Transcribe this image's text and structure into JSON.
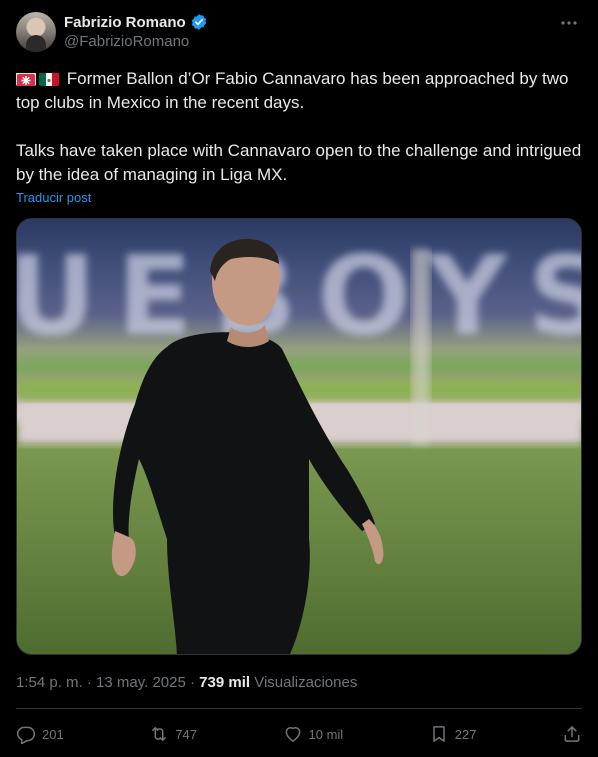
{
  "author": {
    "name": "Fabrizio Romano",
    "handle": "@FabrizioRomano",
    "verified": true
  },
  "post": {
    "line1": "Former Ballon d’Or Fabio Cannavaro has been approached by two top clubs in Mexico in the recent days.",
    "line2": "Talks have taken place with Cannavaro open to the challenge and intrigued by the idea of managing in Liga MX.",
    "flags": [
      "siren-icon",
      "mexico-flag-icon"
    ],
    "translate_label": "Traducir post"
  },
  "media": {
    "background_text": "UEBOYS"
  },
  "meta": {
    "time": "1:54 p. m.",
    "separator": "·",
    "date": "13 may. 2025",
    "views_count": "739 mil",
    "views_label": "Visualizaciones"
  },
  "actions": {
    "replies": "201",
    "reposts": "747",
    "likes": "10 mil",
    "bookmarks": "227"
  },
  "colors": {
    "accent": "#1d9bf0",
    "muted": "#71767b",
    "text": "#e7e9ea",
    "background": "#000000"
  }
}
